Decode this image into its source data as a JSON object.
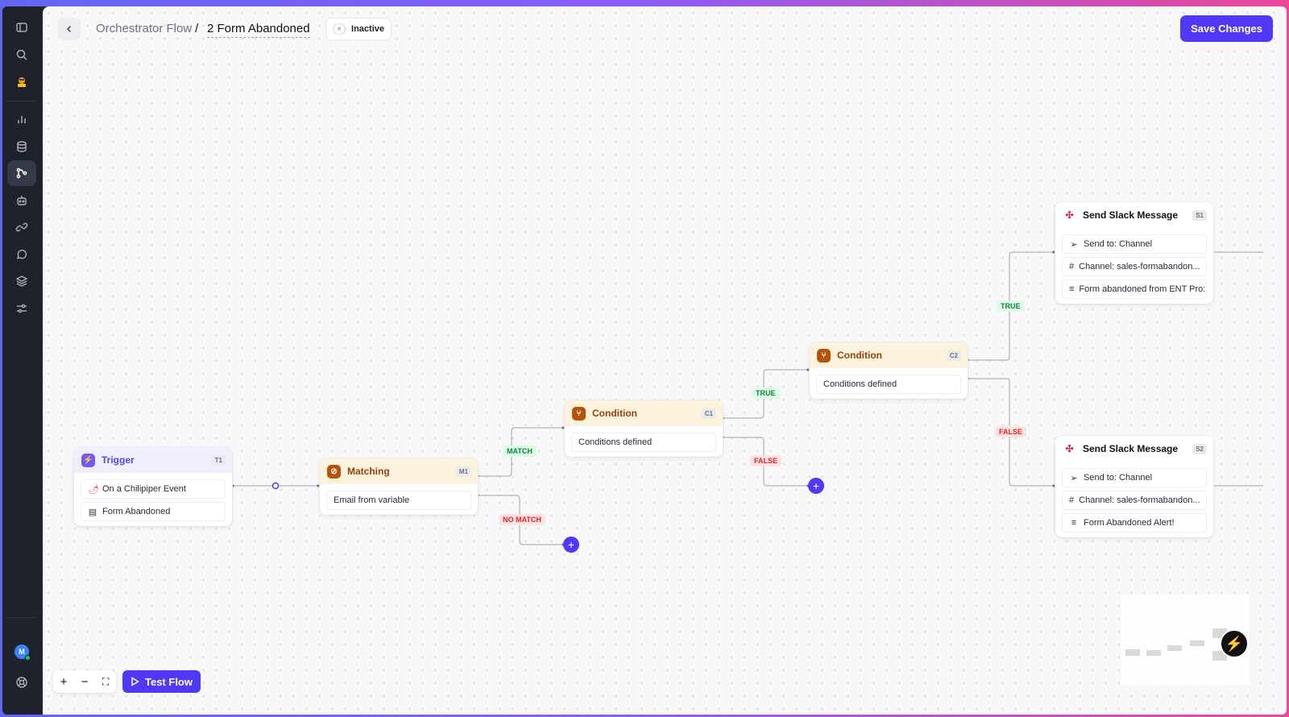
{
  "breadcrumb": {
    "root": "Orchestrator Flow",
    "separator": "/",
    "current": "2 Form Abandoned"
  },
  "status": {
    "label": "Inactive",
    "active": false
  },
  "save_button": "Save Changes",
  "test_button": "Test Flow",
  "nodes": {
    "trigger": {
      "title": "Trigger",
      "tag": "T1",
      "rows": [
        "On a Chilipiper Event",
        "Form Abandoned"
      ]
    },
    "matching": {
      "title": "Matching",
      "tag": "M1",
      "rows": [
        "Email from variable"
      ]
    },
    "condition1": {
      "title": "Condition",
      "tag": "C1",
      "rows": [
        "Conditions defined"
      ]
    },
    "condition2": {
      "title": "Condition",
      "tag": "C2",
      "rows": [
        "Conditions defined"
      ]
    },
    "slack1": {
      "title": "Send Slack Message",
      "tag": "S1",
      "rows": [
        "Send to: Channel",
        "Channel: sales-formabandon...",
        "Form abandoned from ENT Pro:"
      ]
    },
    "slack2": {
      "title": "Send Slack Message",
      "tag": "S2",
      "rows": [
        "Send to: Channel",
        "Channel: sales-formabandon...",
        "Form Abandoned Alert!"
      ]
    }
  },
  "edge_labels": {
    "match": "MATCH",
    "no_match": "NO MATCH",
    "c1_true": "TRUE",
    "c1_false": "FALSE",
    "c2_true": "TRUE",
    "c2_false": "FALSE"
  },
  "colors": {
    "accent": "#4f39f6",
    "true": "#15803d",
    "false": "#dc2626",
    "condition": "#b45309"
  },
  "avatar_initial": "M"
}
